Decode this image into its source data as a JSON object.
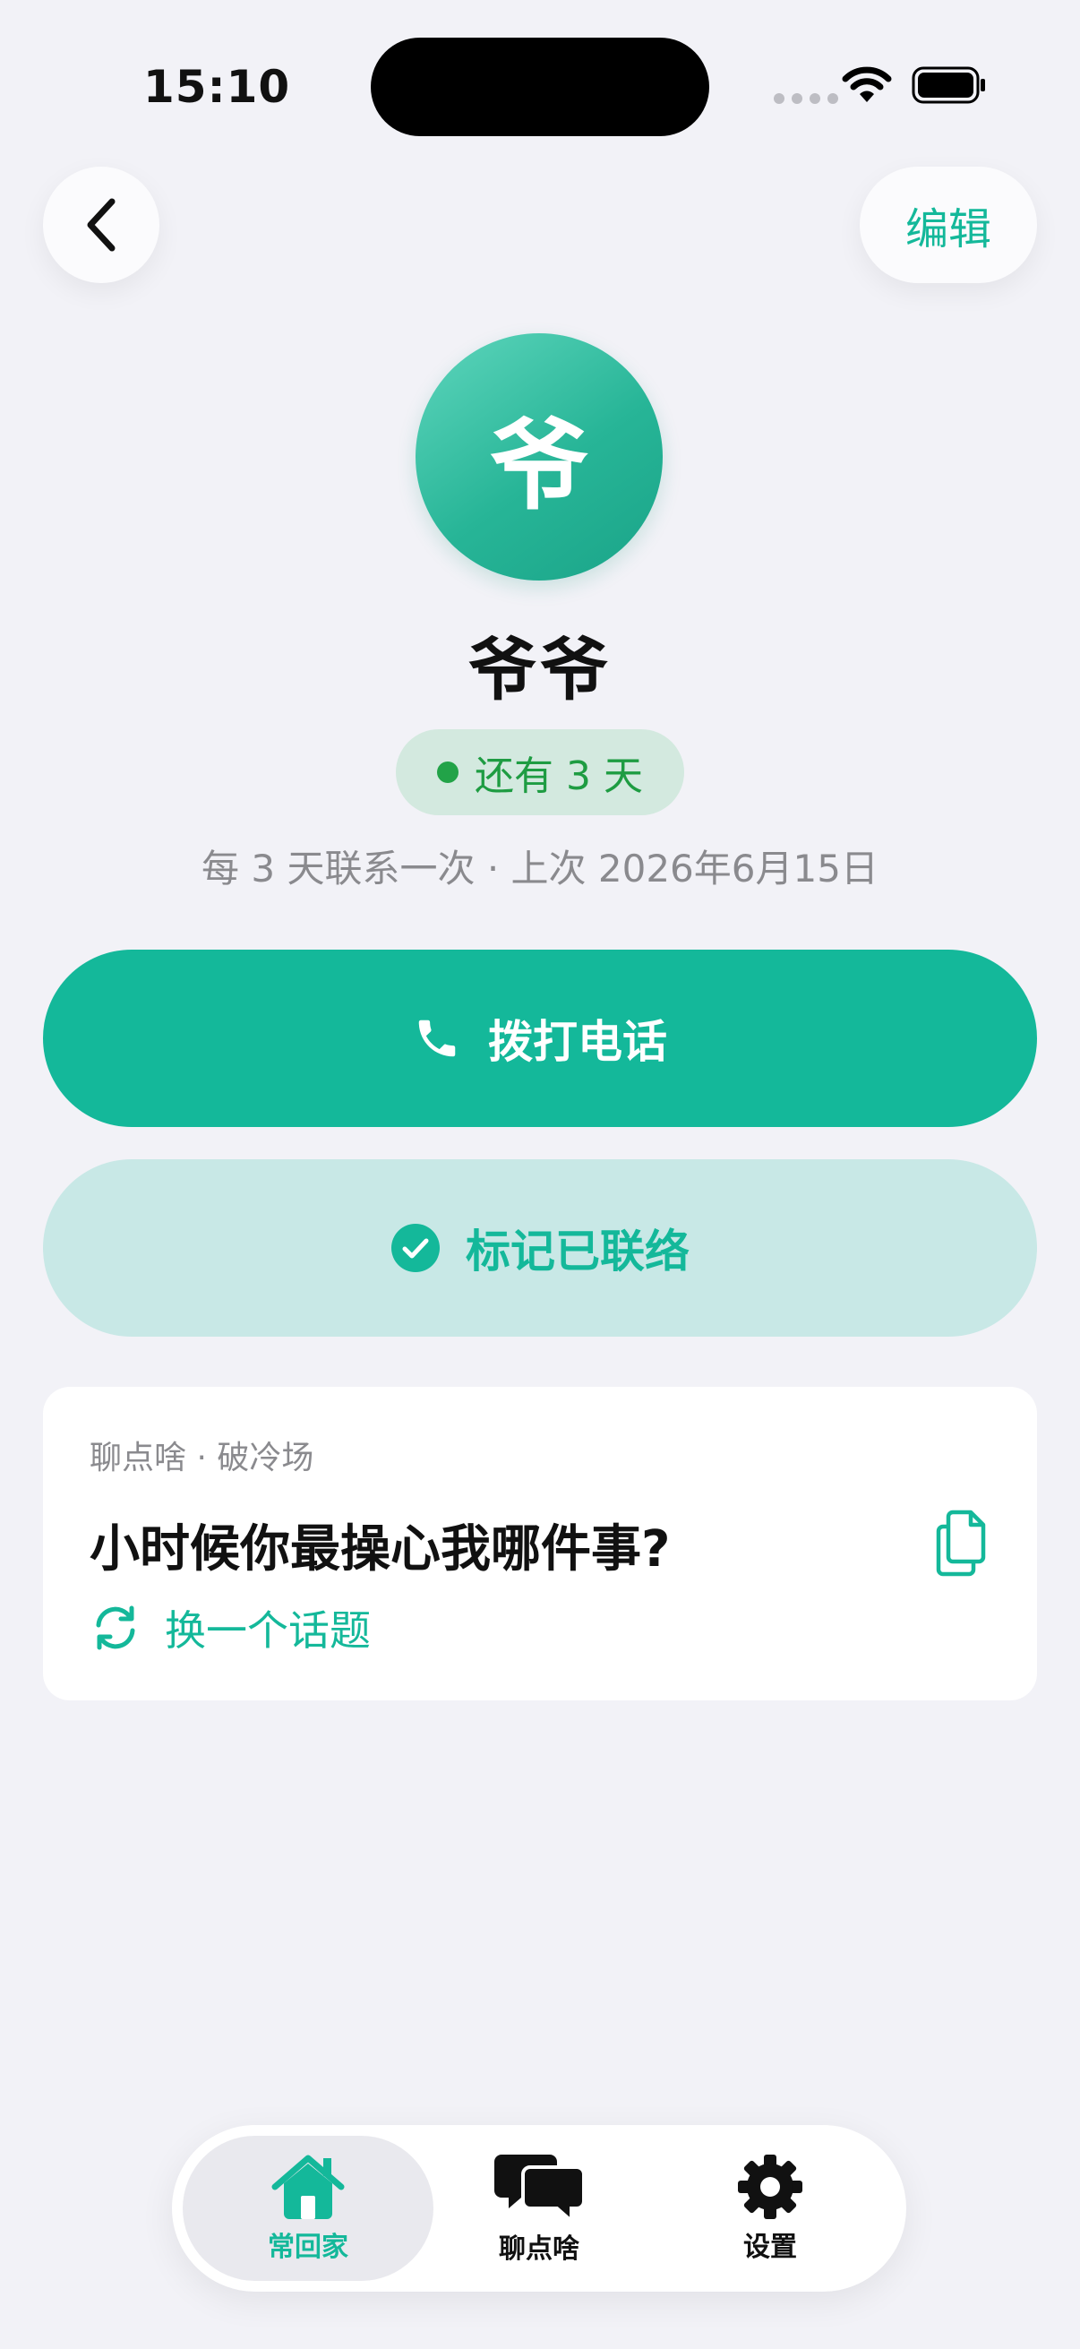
{
  "status_bar": {
    "time": "15:10"
  },
  "header": {
    "edit_label": "编辑"
  },
  "contact": {
    "avatar_char": "爷",
    "name": "爷爷",
    "badge": "还有 3 天",
    "schedule": "每 3 天联系一次 · 上次 2026年6月15日"
  },
  "actions": {
    "call_label": "拨打电话",
    "mark_label": "标记已联络"
  },
  "topic_card": {
    "label": "聊点啥 · 破冷场",
    "question": "小时候你最操心我哪件事?",
    "shuffle_label": "换一个话题"
  },
  "tab_bar": {
    "tabs": [
      {
        "label": "常回家",
        "icon": "house-icon",
        "active": true
      },
      {
        "label": "聊点啥",
        "icon": "chat-bubbles-icon",
        "active": false
      },
      {
        "label": "设置",
        "icon": "gear-icon",
        "active": false
      }
    ]
  },
  "colors": {
    "accent": "#14b89a",
    "background": "#f2f2f7",
    "badge_bg": "#d3e9df",
    "badge_text": "#1e9c42",
    "secondary_button_bg": "#c8e8e6"
  }
}
